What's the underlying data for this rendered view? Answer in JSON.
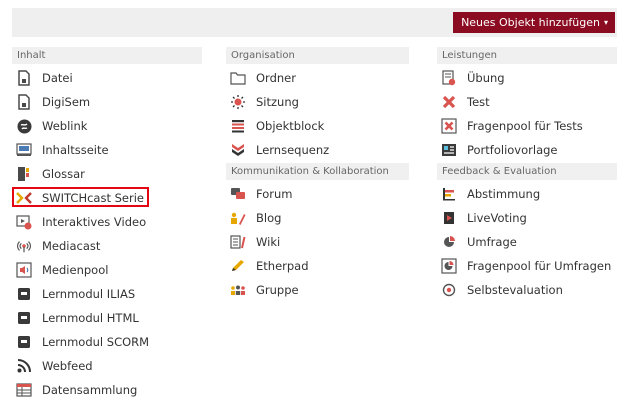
{
  "toolbar": {
    "new_object_label": "Neues Objekt hinzufügen",
    "caret": "▾"
  },
  "colors": {
    "accent": "#8b0b20",
    "highlight_box": "#e30613",
    "header_bg": "#f0f0f0"
  },
  "columns": {
    "inhalt": {
      "header": "Inhalt",
      "items": [
        {
          "label": "Datei",
          "icon": "file-icon"
        },
        {
          "label": "DigiSem",
          "icon": "digisem-icon"
        },
        {
          "label": "Weblink",
          "icon": "weblink-icon"
        },
        {
          "label": "Inhaltsseite",
          "icon": "content-page-icon"
        },
        {
          "label": "Glossar",
          "icon": "glossary-icon"
        },
        {
          "label": "SWITCHcast Serie",
          "icon": "switchcast-icon",
          "highlighted": true
        },
        {
          "label": "Interaktives Video",
          "icon": "interactive-video-icon"
        },
        {
          "label": "Mediacast",
          "icon": "mediacast-icon"
        },
        {
          "label": "Medienpool",
          "icon": "mediapool-icon"
        },
        {
          "label": "Lernmodul ILIAS",
          "icon": "learning-module-icon"
        },
        {
          "label": "Lernmodul HTML",
          "icon": "learning-module-icon"
        },
        {
          "label": "Lernmodul SCORM",
          "icon": "learning-module-icon"
        },
        {
          "label": "Webfeed",
          "icon": "webfeed-icon"
        },
        {
          "label": "Datensammlung",
          "icon": "data-collection-icon"
        }
      ]
    },
    "organisation": {
      "header": "Organisation",
      "items": [
        {
          "label": "Ordner",
          "icon": "folder-icon"
        },
        {
          "label": "Sitzung",
          "icon": "session-icon"
        },
        {
          "label": "Objektblock",
          "icon": "object-block-icon"
        },
        {
          "label": "Lernsequenz",
          "icon": "learning-sequence-icon"
        }
      ]
    },
    "kommunikation": {
      "header": "Kommunikation & Kollaboration",
      "items": [
        {
          "label": "Forum",
          "icon": "forum-icon"
        },
        {
          "label": "Blog",
          "icon": "blog-icon"
        },
        {
          "label": "Wiki",
          "icon": "wiki-icon"
        },
        {
          "label": "Etherpad",
          "icon": "etherpad-icon"
        },
        {
          "label": "Gruppe",
          "icon": "group-icon"
        }
      ]
    },
    "leistungen": {
      "header": "Leistungen",
      "items": [
        {
          "label": "Übung",
          "icon": "exercise-icon"
        },
        {
          "label": "Test",
          "icon": "test-icon"
        },
        {
          "label": "Fragenpool für Tests",
          "icon": "question-pool-icon"
        },
        {
          "label": "Portfoliovorlage",
          "icon": "portfolio-template-icon"
        }
      ]
    },
    "feedback": {
      "header": "Feedback & Evaluation",
      "items": [
        {
          "label": "Abstimmung",
          "icon": "poll-icon"
        },
        {
          "label": "LiveVoting",
          "icon": "livevoting-icon"
        },
        {
          "label": "Umfrage",
          "icon": "survey-icon"
        },
        {
          "label": "Fragenpool für Umfragen",
          "icon": "survey-pool-icon"
        },
        {
          "label": "Selbstevaluation",
          "icon": "self-evaluation-icon"
        }
      ]
    }
  }
}
